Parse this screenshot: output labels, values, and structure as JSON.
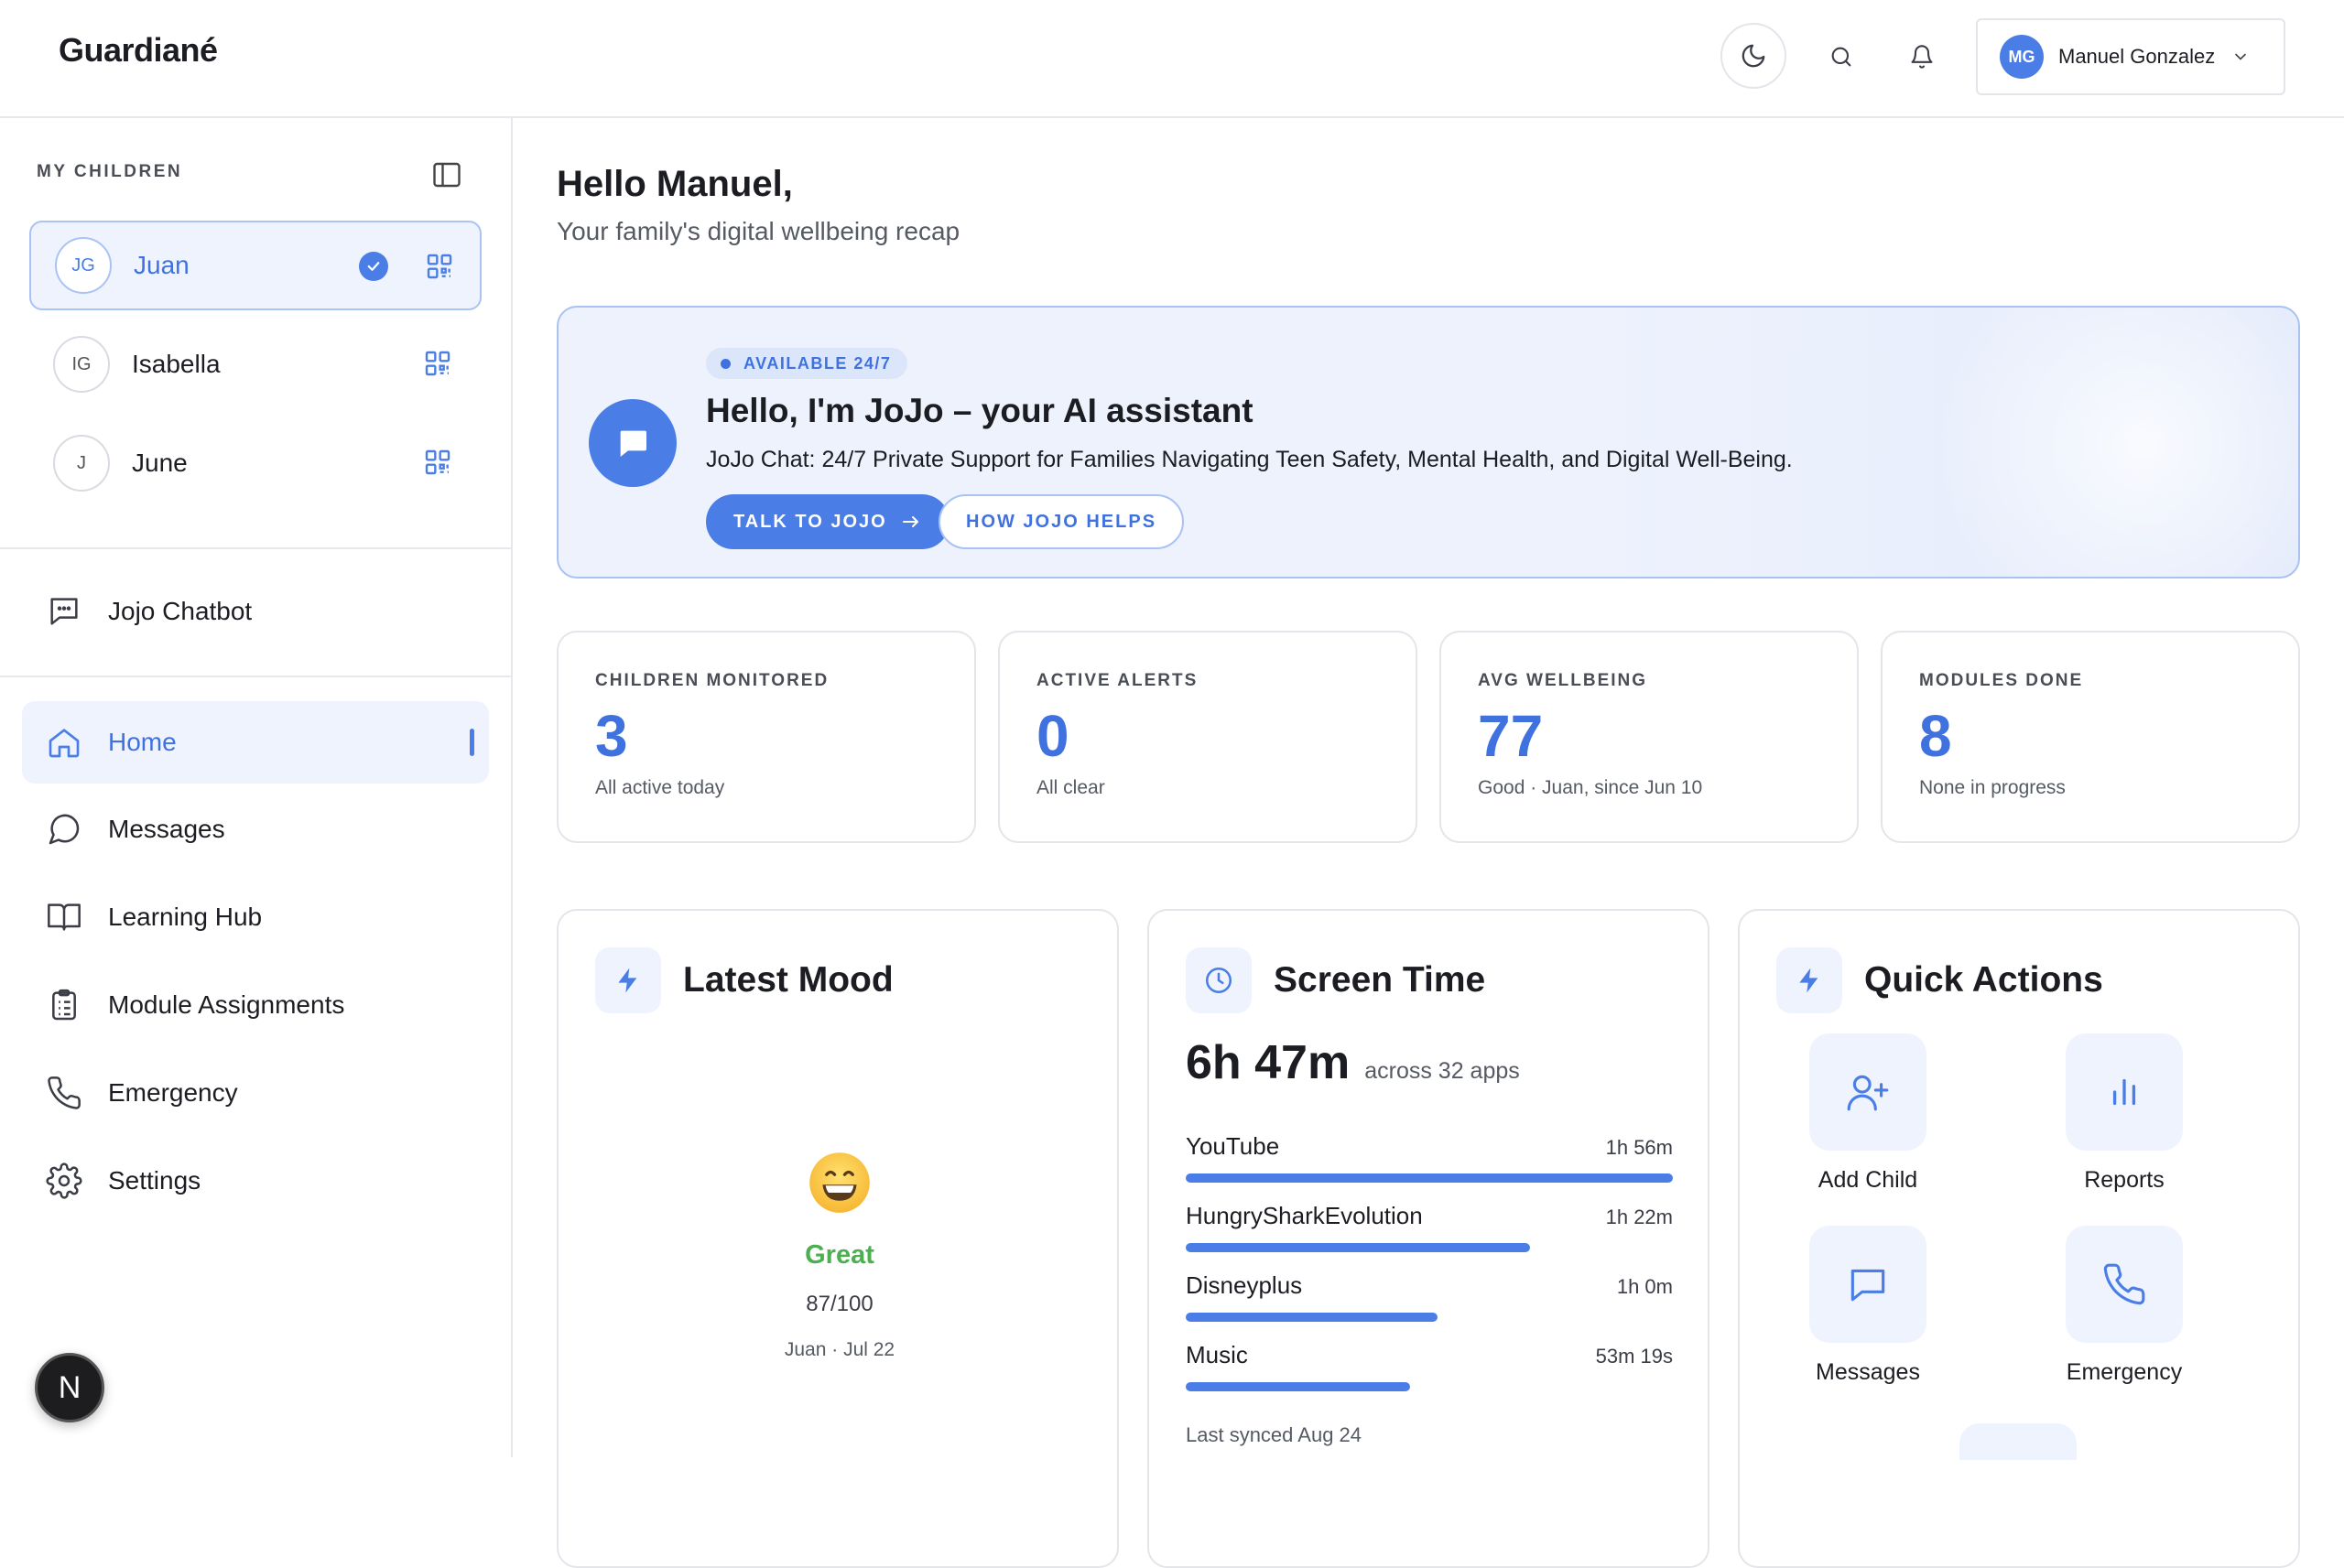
{
  "app": {
    "logo": "Guardiané"
  },
  "header": {
    "user": {
      "initials": "MG",
      "name": "Manuel Gonzalez"
    }
  },
  "sidebar": {
    "section_label": "MY CHILDREN",
    "children": [
      {
        "initials": "JG",
        "name": "Juan",
        "selected": true
      },
      {
        "initials": "IG",
        "name": "Isabella",
        "selected": false
      },
      {
        "initials": "J",
        "name": "June",
        "selected": false
      }
    ],
    "chatbot_label": "Jojo Chatbot",
    "nav": [
      {
        "label": "Home",
        "icon": "home-icon",
        "active": true
      },
      {
        "label": "Messages",
        "icon": "message-circle-icon",
        "active": false
      },
      {
        "label": "Learning Hub",
        "icon": "book-open-icon",
        "active": false
      },
      {
        "label": "Module Assignments",
        "icon": "clipboard-icon",
        "active": false
      },
      {
        "label": "Emergency",
        "icon": "phone-icon",
        "active": false
      },
      {
        "label": "Settings",
        "icon": "gear-icon",
        "active": false
      }
    ],
    "badge_letter": "N"
  },
  "greeting": {
    "title": "Hello Manuel,",
    "subtitle": "Your family's digital wellbeing recap"
  },
  "banner": {
    "badge": "AVAILABLE 24/7",
    "title": "Hello, I'm JoJo – your AI assistant",
    "description": "JoJo Chat: 24/7 Private Support for Families Navigating Teen Safety, Mental Health, and Digital Well-Being.",
    "primary_button": "TALK TO JOJO",
    "secondary_button": "HOW JOJO HELPS"
  },
  "stats": [
    {
      "label": "CHILDREN MONITORED",
      "value": "3",
      "sub": "All active today"
    },
    {
      "label": "ACTIVE ALERTS",
      "value": "0",
      "sub": "All clear"
    },
    {
      "label": "AVG WELLBEING",
      "value": "77",
      "sub": "Good · Juan, since Jun 10"
    },
    {
      "label": "MODULES DONE",
      "value": "8",
      "sub": "None in progress"
    }
  ],
  "mood": {
    "title": "Latest Mood",
    "label": "Great",
    "score": "87/100",
    "meta": "Juan · Jul 22"
  },
  "screen_time": {
    "title": "Screen Time",
    "total": "6h 47m",
    "apps_text": "across 32 apps",
    "apps": [
      {
        "name": "YouTube",
        "time": "1h 56m",
        "fraction": 1.0
      },
      {
        "name": "HungrySharkEvolution",
        "time": "1h 22m",
        "fraction": 0.707
      },
      {
        "name": "Disneyplus",
        "time": "1h 0m",
        "fraction": 0.517
      },
      {
        "name": "Music",
        "time": "53m 19s",
        "fraction": 0.46
      }
    ],
    "synced": "Last synced Aug 24"
  },
  "quick_actions": {
    "title": "Quick Actions",
    "items": [
      {
        "label": "Add Child",
        "icon": "user-plus-icon"
      },
      {
        "label": "Reports",
        "icon": "bar-chart-icon"
      },
      {
        "label": "Messages",
        "icon": "message-square-icon"
      },
      {
        "label": "Emergency",
        "icon": "phone-icon"
      }
    ]
  },
  "colors": {
    "accent": "#4a7ee6",
    "mood_great": "#4caf50",
    "surface_tint": "#eef3fe"
  }
}
